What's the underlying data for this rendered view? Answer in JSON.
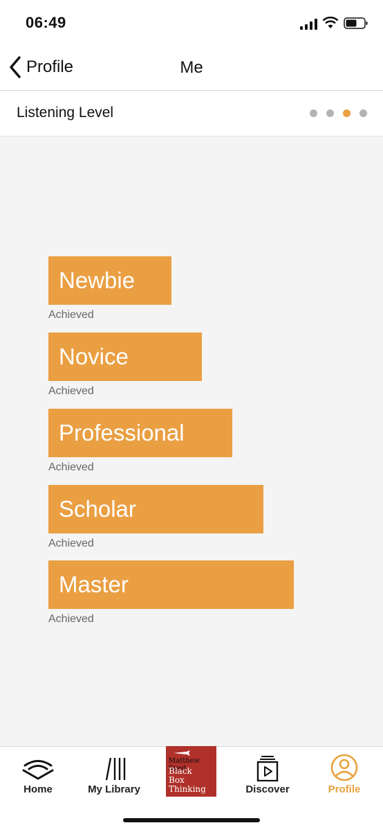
{
  "status_bar": {
    "time": "06:49"
  },
  "nav": {
    "back_label": "Profile",
    "title": "Me"
  },
  "section": {
    "title": "Listening Level",
    "page_count": 4,
    "active_page": 3
  },
  "levels": [
    {
      "name": "Newbie",
      "status": "Achieved"
    },
    {
      "name": "Novice",
      "status": "Achieved"
    },
    {
      "name": "Professional",
      "status": "Achieved"
    },
    {
      "name": "Scholar",
      "status": "Achieved"
    },
    {
      "name": "Master",
      "status": "Achieved"
    }
  ],
  "tabs": [
    {
      "label": "Home",
      "icon": "audible-home-icon"
    },
    {
      "label": "My Library",
      "icon": "library-icon"
    },
    {
      "label": "Discover",
      "icon": "discover-icon"
    },
    {
      "label": "Profile",
      "icon": "profile-icon",
      "active": true
    }
  ],
  "now_playing": {
    "author": "Matthew Syed",
    "title_line1": "Black",
    "title_line2": "Box",
    "title_line3": "Thinking"
  },
  "colors": {
    "accent": "#ea9f42",
    "active_tab": "#e9a23b",
    "dot_inactive": "#b3b3b3"
  }
}
